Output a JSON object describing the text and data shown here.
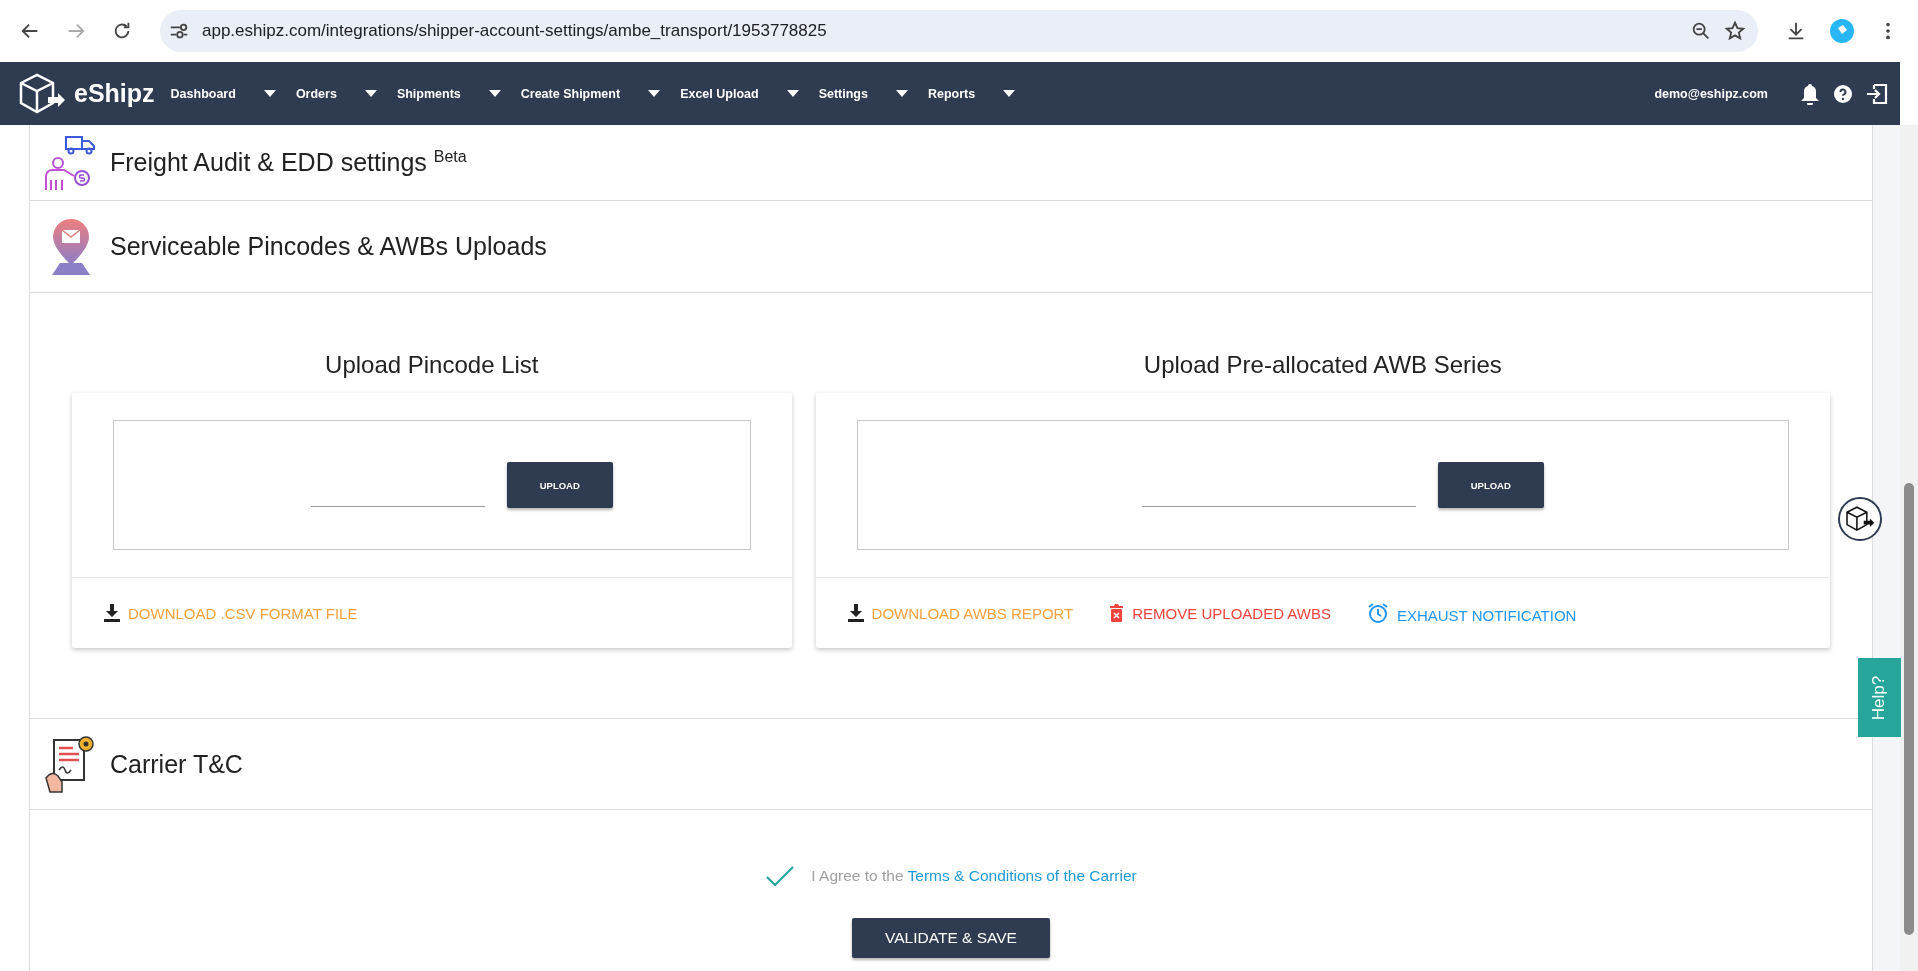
{
  "browser": {
    "url": "app.eshipz.com/integrations/shipper-account-settings/ambe_transport/1953778825"
  },
  "navbar": {
    "brand": "eShipz",
    "menu": [
      {
        "label": "Dashboard"
      },
      {
        "label": "Orders"
      },
      {
        "label": "Shipments"
      },
      {
        "label": "Create Shipment"
      },
      {
        "label": "Excel Upload"
      },
      {
        "label": "Settings"
      },
      {
        "label": "Reports"
      }
    ],
    "user": "demo@eshipz.com"
  },
  "freight_section": {
    "title": "Freight Audit & EDD settings $^{Beta}$"
  },
  "pincodes_section": {
    "title": "Serviceable Pincodes & AWBs Uploads",
    "panels": [
      {
        "heading": "Upload Pincode List",
        "upload_button": "UPLOAD",
        "actions": [
          {
            "kind": "download",
            "label": "DOWNLOAD .CSV FORMAT FILE"
          }
        ]
      },
      {
        "heading": "Upload Pre-allocated AWB Series",
        "upload_button": "UPLOAD",
        "actions": [
          {
            "kind": "download",
            "label": "DOWNLOAD AWBS REPORT"
          },
          {
            "kind": "remove",
            "label": "REMOVE UPLOADED AWBS"
          },
          {
            "kind": "notify",
            "label": "EXHAUST NOTIFICATION"
          }
        ]
      }
    ]
  },
  "carrier_tc_section": {
    "title": "Carrier T&C",
    "agreement": {
      "checked": true,
      "text": "I Agree to the",
      "link": "Terms & Conditions of the Carrier"
    },
    "save_button": "VALIDATE & SAVE"
  },
  "help_tab": "Help?"
}
